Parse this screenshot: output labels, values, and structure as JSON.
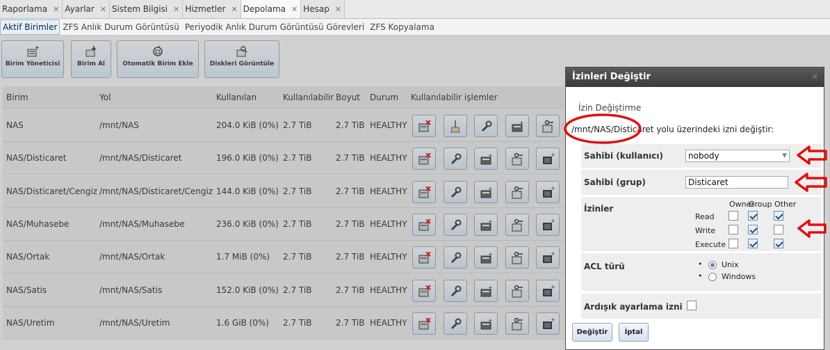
{
  "tabs": [
    {
      "label": "Raporlama",
      "close": "✕"
    },
    {
      "label": "Ayarlar",
      "close": "✕"
    },
    {
      "label": "Sistem Bilgisi",
      "close": "✕"
    },
    {
      "label": "Hizmetler",
      "close": "✕"
    },
    {
      "label": "Depolama",
      "close": "✕"
    },
    {
      "label": "Hesap",
      "close": "✕"
    }
  ],
  "subtabs": [
    "Aktif Birimler",
    "ZFS Anlık Durum Görüntüsü",
    "Periyodik Anlık Durum Görüntüsü Görevleri",
    "ZFS Kopyalama"
  ],
  "toolbar": [
    "Birim Yöneticisi",
    "Birim Al",
    "Otomatik Birim Ekle",
    "Diskleri Görüntüle"
  ],
  "table": {
    "headers": [
      "Birim",
      "Yol",
      "Kullanılan",
      "Kullanılabilir",
      "Boyut",
      "Durum",
      "Kullanılabilir işlemler"
    ],
    "rows": [
      [
        "NAS",
        "/mnt/NAS",
        "204.0 KiB (0%)",
        "2.7 TiB",
        "2.7 TiB",
        "HEALTHY"
      ],
      [
        "NAS/Disticaret",
        "/mnt/NAS/Disticaret",
        "196.0 KiB (0%)",
        "2.7 TiB",
        "2.7 TiB",
        "HEALTHY"
      ],
      [
        "NAS/Disticaret/Cengiz",
        "/mnt/NAS/Disticaret/Cengiz",
        "144.0 KiB (0%)",
        "2.7 TiB",
        "2.7 TiB",
        "HEALTHY"
      ],
      [
        "NAS/Muhasebe",
        "/mnt/NAS/Muhasebe",
        "236.0 KiB (0%)",
        "2.7 TiB",
        "2.7 TiB",
        "HEALTHY"
      ],
      [
        "NAS/Ortak",
        "/mnt/NAS/Ortak",
        "1.7 MiB (0%)",
        "2.7 TiB",
        "2.7 TiB",
        "HEALTHY"
      ],
      [
        "NAS/Satis",
        "/mnt/NAS/Satis",
        "152.0 KiB (0%)",
        "2.7 TiB",
        "2.7 TiB",
        "HEALTHY"
      ],
      [
        "NAS/Uretim",
        "/mnt/NAS/Uretim",
        "1.6 GiB (0%)",
        "2.7 TiB",
        "2.7 TiB",
        "HEALTHY"
      ]
    ]
  },
  "dialog": {
    "title": "İzinleri Değiştir",
    "close": "✕",
    "legend": "İzin Değiştirme",
    "description": "/mnt/NAS/Disticaret yolu üzerindeki izni değiştir:",
    "owner_user_label": "Sahibi (kullanıcı)",
    "owner_user_value": "nobody",
    "owner_group_label": "Sahibi (grup)",
    "owner_group_value": "Disticaret",
    "permissions_label": "İzinler",
    "perm_cols": [
      "Owner",
      "Group",
      "Other"
    ],
    "perm_rows": [
      {
        "label": "Read",
        "values": [
          false,
          true,
          true
        ]
      },
      {
        "label": "Write",
        "values": [
          false,
          true,
          false
        ]
      },
      {
        "label": "Execute",
        "values": [
          false,
          true,
          true
        ]
      }
    ],
    "acl_label": "ACL türü",
    "acl_options": [
      "Unix",
      "Windows"
    ],
    "acl_selected": "Unix",
    "recursive_label": "Ardışık ayarlama izni",
    "recursive_checked": false,
    "submit_label": "Değiştir",
    "cancel_label": "İptal"
  },
  "colors": {
    "annotation": "#e01010",
    "accent": "#5a86b8"
  }
}
